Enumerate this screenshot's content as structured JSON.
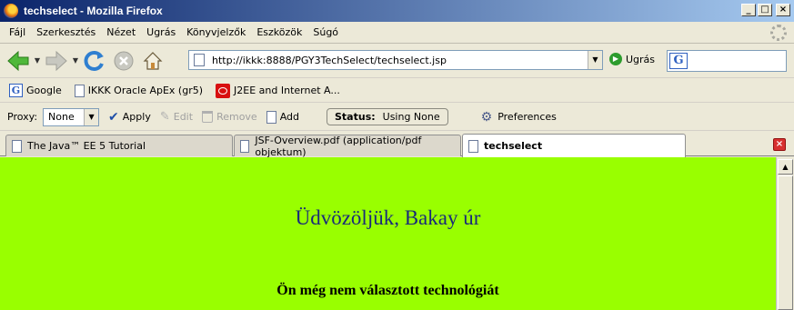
{
  "window": {
    "title": "techselect - Mozilla Firefox"
  },
  "menu": [
    {
      "label": "Fájl"
    },
    {
      "label": "Szerkesztés"
    },
    {
      "label": "Nézet"
    },
    {
      "label": "Ugrás"
    },
    {
      "label": "Könyvjelzők"
    },
    {
      "label": "Eszközök"
    },
    {
      "label": "Súgó"
    }
  ],
  "navbar": {
    "url": "http://ikkk:8888/PGY3TechSelect/techselect.jsp",
    "go_label": "Ugrás",
    "search_value": ""
  },
  "bookmarks": [
    {
      "label": "Google",
      "icon": "google-icon"
    },
    {
      "label": "IKKK Oracle ApEx (gr5)",
      "icon": "page-icon"
    },
    {
      "label": "J2EE and Internet A...",
      "icon": "oracle-icon"
    }
  ],
  "proxybar": {
    "proxy_label": "Proxy:",
    "proxy_value": "None",
    "apply": "Apply",
    "edit": "Edit",
    "remove": "Remove",
    "add": "Add",
    "status_label": "Status:",
    "status_value": "Using None",
    "preferences": "Preferences"
  },
  "tabs": [
    {
      "label": "The Java™ EE 5 Tutorial",
      "active": false
    },
    {
      "label": "JSF-Overview.pdf (application/pdf objektum)",
      "active": false
    },
    {
      "label": "techselect",
      "active": true
    }
  ],
  "page": {
    "welcome": "Üdvözöljük, Bakay úr",
    "message": "Ön még nem választott technológiát",
    "background": "#99ff00"
  }
}
